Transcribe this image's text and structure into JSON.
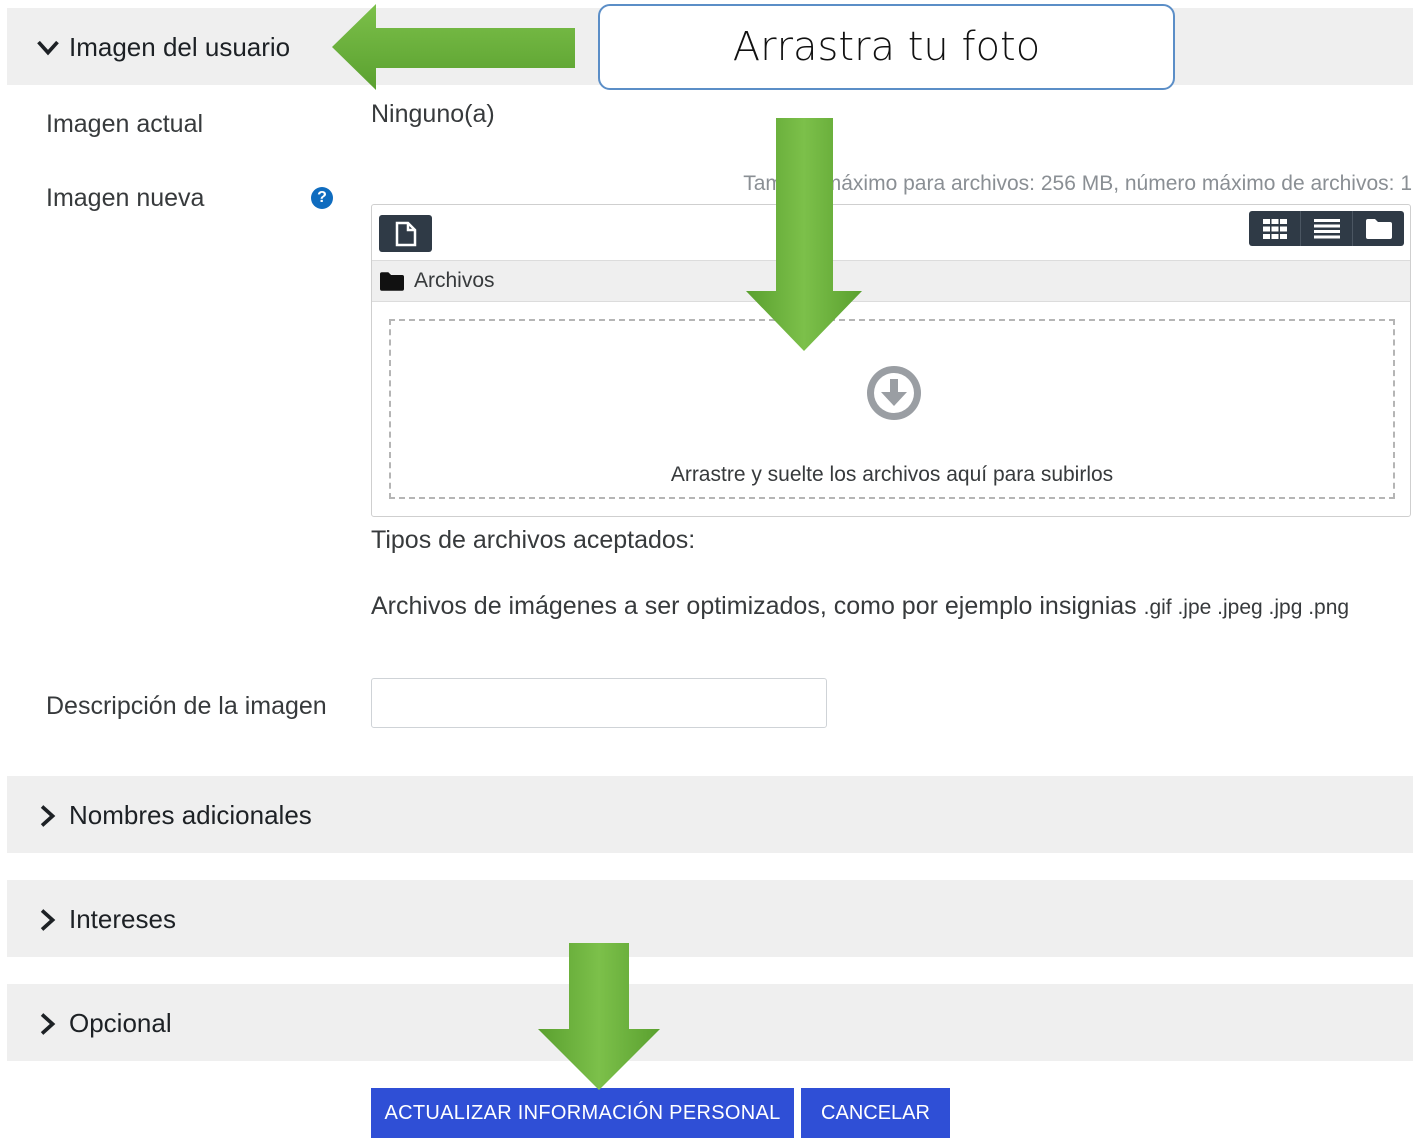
{
  "sections": {
    "user_image": {
      "title": "Imagen del usuario",
      "expanded": true
    },
    "additional_names": {
      "title": "Nombres adicionales",
      "expanded": false
    },
    "interests": {
      "title": "Intereses",
      "expanded": false
    },
    "optional": {
      "title": "Opcional",
      "expanded": false
    }
  },
  "callout": {
    "text": "Arrastra tu foto"
  },
  "fields": {
    "current_image": {
      "label": "Imagen actual",
      "value": "Ninguno(a)"
    },
    "new_image": {
      "label": "Imagen nueva",
      "help_icon": "question-circle-icon"
    },
    "image_description": {
      "label": "Descripción de la imagen",
      "value": ""
    }
  },
  "filepicker": {
    "max_size_text": "Tamaño máximo para archivos: 256 MB, número máximo de archivos: 1",
    "path_label": "Archivos",
    "dropzone_text": "Arrastre y suelte los archivos aquí para subirlos",
    "add_icon": "file-icon",
    "view_icons": [
      "grid-icon",
      "list-icon",
      "folder-icon"
    ]
  },
  "accepted": {
    "heading": "Tipos de archivos aceptados:",
    "description": "Archivos de imágenes a ser optimizados, como por ejemplo insignias",
    "extensions": ".gif .jpe .jpeg .jpg .png"
  },
  "buttons": {
    "submit": "ACTUALIZAR INFORMACIÓN PERSONAL",
    "cancel": "CANCELAR"
  },
  "colors": {
    "primary": "#2f4fd6",
    "section_bg": "#efefef",
    "arrow_green": "#6db33f",
    "help_blue": "#0f6cbf"
  }
}
